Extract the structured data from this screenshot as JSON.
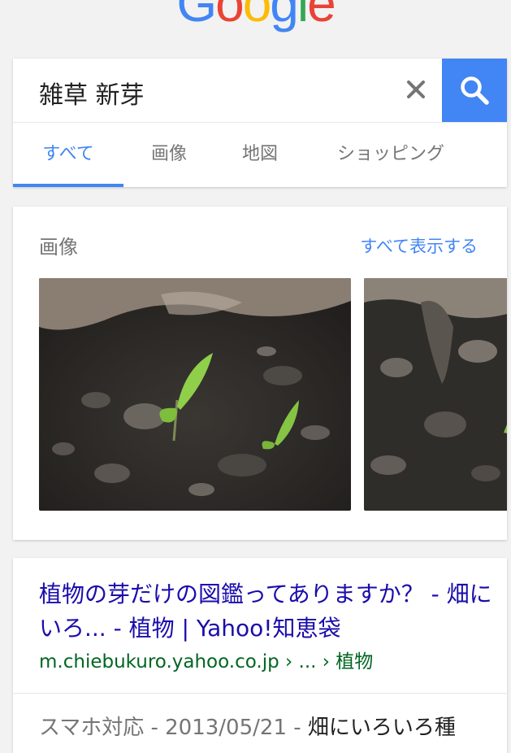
{
  "logo": {
    "letters": [
      "G",
      "o",
      "o",
      "g",
      "l",
      "e"
    ],
    "colors": [
      "#4285f4",
      "#ea4335",
      "#fbbc05",
      "#4285f4",
      "#34a853",
      "#ea4335"
    ]
  },
  "search": {
    "query": "雑草 新芽",
    "clear_icon": "close-icon",
    "search_icon": "search-icon"
  },
  "tabs": [
    {
      "label": "すべて",
      "active": true
    },
    {
      "label": "画像",
      "active": false
    },
    {
      "label": "地図",
      "active": false
    },
    {
      "label": "ショッピング",
      "active": false
    }
  ],
  "images_section": {
    "title": "画像",
    "see_all": "すべて表示する"
  },
  "result": {
    "title": "植物の芽だけの図鑑ってありますか？ - 畑にいろ... - 植物 | Yahoo!知恵袋",
    "url": "m.chiebukuro.yahoo.co.jp › ... › 植物",
    "snippet_meta": "スマホ対応 - 2013/05/21 - ",
    "snippet_text": "畑にいろいろ種"
  },
  "colors": {
    "accent": "#4285f4",
    "link": "#1a0dab",
    "url": "#006621",
    "muted": "#757575"
  }
}
